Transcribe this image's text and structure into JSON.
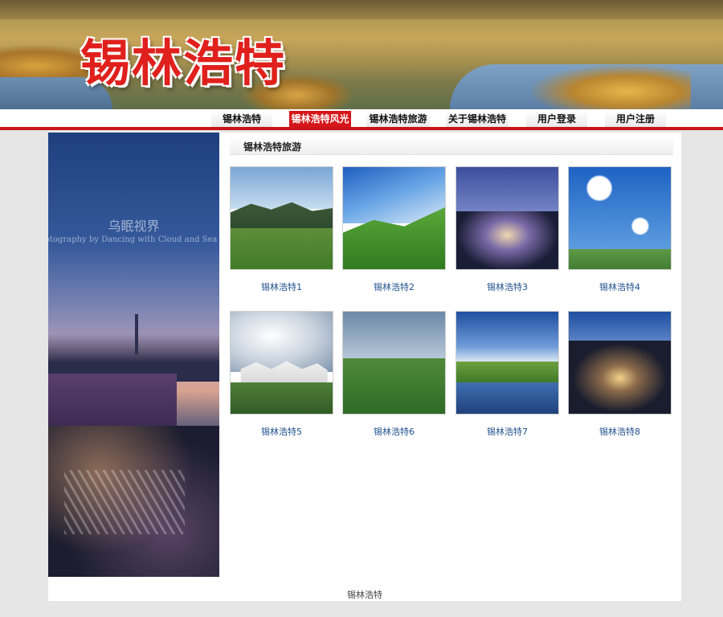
{
  "banner": {
    "title": "锡林浩特"
  },
  "nav": {
    "items": [
      "锡林浩特",
      "锡林浩特风光",
      "锡林浩特旅游",
      "关于锡林浩特",
      "用户登录",
      "用户注册"
    ],
    "active_index": 1
  },
  "sidebar": {
    "watermark_title": "乌眠视界",
    "watermark_text": "otography by Dancing with Cloud and Sea"
  },
  "section": {
    "title": "锡林浩特旅游"
  },
  "gallery": {
    "items": [
      {
        "caption": "锡林浩特1",
        "icon": "grassland-mountain-photo"
      },
      {
        "caption": "锡林浩特2",
        "icon": "green-hills-photo"
      },
      {
        "caption": "锡林浩特3",
        "icon": "city-night-photo"
      },
      {
        "caption": "锡林浩特4",
        "icon": "blue-sky-clouds-photo"
      },
      {
        "caption": "锡林浩特5",
        "icon": "yurts-photo"
      },
      {
        "caption": "锡林浩特6",
        "icon": "sheep-grassland-photo"
      },
      {
        "caption": "锡林浩特7",
        "icon": "horses-lake-photo"
      },
      {
        "caption": "锡林浩特8",
        "icon": "city-aerial-night-photo"
      }
    ]
  },
  "footer": {
    "text": "锡林浩特"
  },
  "colors": {
    "accent": "#d61518",
    "link": "#1f4f8e",
    "background": "#e6e6e6"
  }
}
